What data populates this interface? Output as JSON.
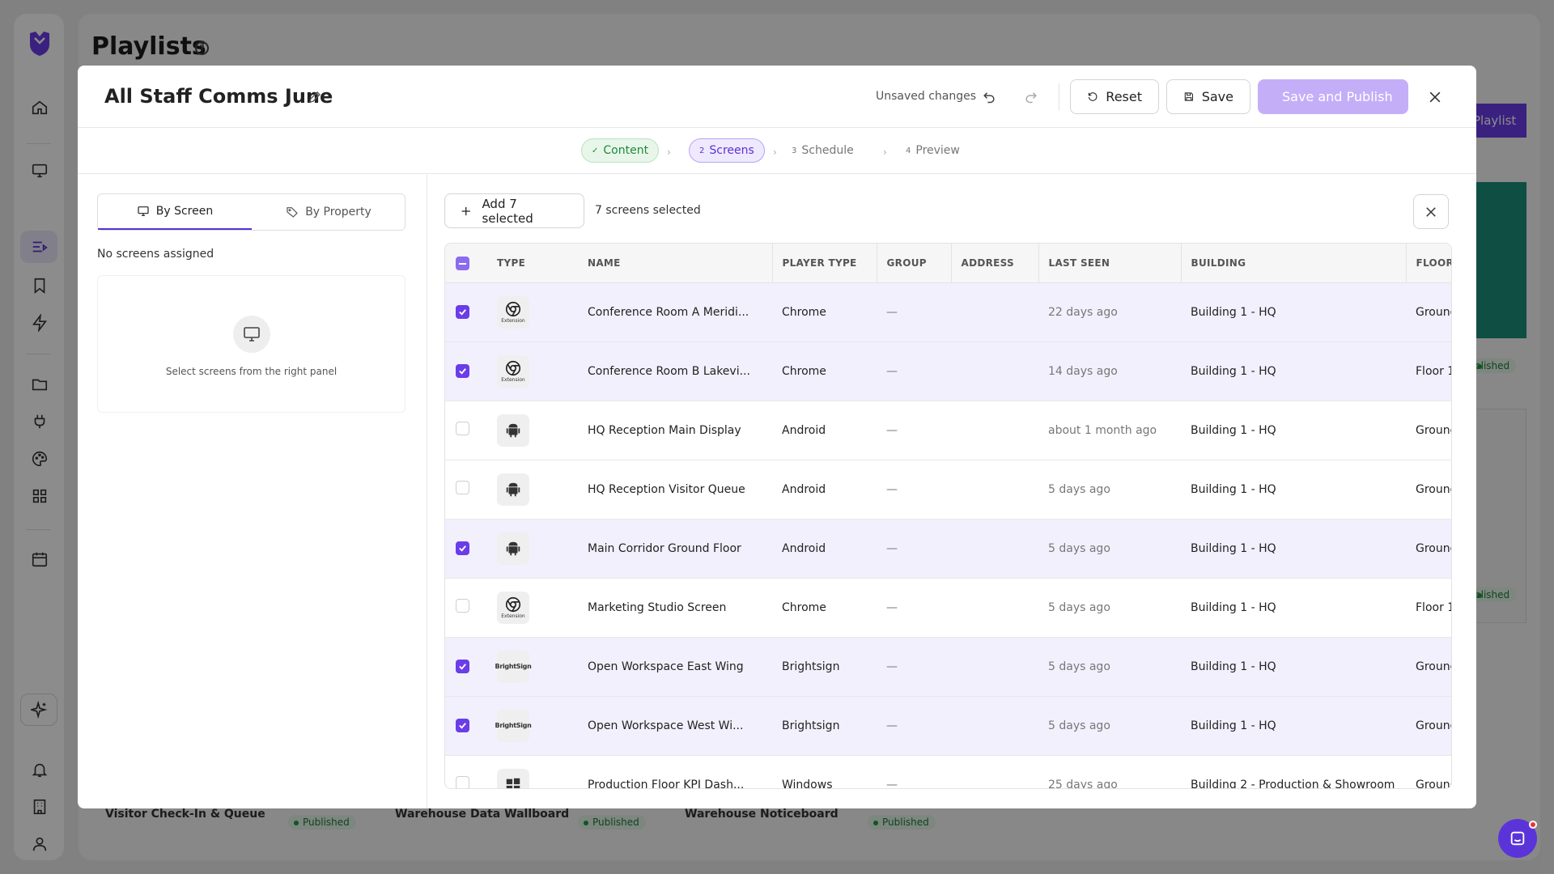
{
  "background": {
    "page_title": "Playlists",
    "new_button_label": "Playlist",
    "cards": [
      {
        "name": "Visitor Check-In & Queue",
        "status": "Published"
      },
      {
        "name": "Warehouse Data Wallboard",
        "status": "Published"
      },
      {
        "name": "Warehouse Noticeboard",
        "status": "Published"
      }
    ],
    "side_statuses": [
      "blished",
      "blished"
    ],
    "brand_color": "#6a3de8"
  },
  "modal": {
    "title": "All Staff Comms June",
    "unsaved": "Unsaved changes",
    "reset_label": "Reset",
    "save_label": "Save",
    "publish_label": "Save and Publish"
  },
  "steps": [
    {
      "num": "✓",
      "label": "Content",
      "state": "done"
    },
    {
      "num": "2",
      "label": "Screens",
      "state": "active"
    },
    {
      "num": "3",
      "label": "Schedule",
      "state": "pending"
    },
    {
      "num": "4",
      "label": "Preview",
      "state": "pending"
    }
  ],
  "left_panel": {
    "tab_screen": "By Screen",
    "tab_property": "By Property",
    "no_screens": "No screens assigned",
    "empty_hint": "Select screens from the right panel"
  },
  "right_panel": {
    "add_label": "Add 7 selected",
    "selected_count": "7 screens selected",
    "columns": [
      "TYPE",
      "NAME",
      "PLAYER TYPE",
      "GROUP",
      "ADDRESS",
      "LAST SEEN",
      "BUILDING",
      "FLOOR"
    ],
    "rows": [
      {
        "checked": true,
        "type": "chrome",
        "name": "Conference Room A Meridi...",
        "player": "Chrome",
        "group": "—",
        "address": "",
        "last_seen": "22 days ago",
        "building": "Building 1 - HQ",
        "floor": "Ground"
      },
      {
        "checked": true,
        "type": "chrome",
        "name": "Conference Room B Lakevi...",
        "player": "Chrome",
        "group": "—",
        "address": "",
        "last_seen": "14 days ago",
        "building": "Building 1 - HQ",
        "floor": "Floor 1"
      },
      {
        "checked": false,
        "type": "android",
        "name": "HQ Reception Main Display",
        "player": "Android",
        "group": "—",
        "address": "",
        "last_seen": "about 1 month ago",
        "building": "Building 1 - HQ",
        "floor": "Ground"
      },
      {
        "checked": false,
        "type": "android",
        "name": "HQ Reception Visitor Queue",
        "player": "Android",
        "group": "—",
        "address": "",
        "last_seen": "5 days ago",
        "building": "Building 1 - HQ",
        "floor": "Ground"
      },
      {
        "checked": true,
        "type": "android",
        "name": "Main Corridor Ground Floor",
        "player": "Android",
        "group": "—",
        "address": "",
        "last_seen": "5 days ago",
        "building": "Building 1 - HQ",
        "floor": "Ground"
      },
      {
        "checked": false,
        "type": "chrome",
        "name": "Marketing Studio Screen",
        "player": "Chrome",
        "group": "—",
        "address": "",
        "last_seen": "5 days ago",
        "building": "Building 1 - HQ",
        "floor": "Floor 1"
      },
      {
        "checked": true,
        "type": "brightsign",
        "name": "Open Workspace East Wing",
        "player": "Brightsign",
        "group": "—",
        "address": "",
        "last_seen": "5 days ago",
        "building": "Building 1 - HQ",
        "floor": "Ground"
      },
      {
        "checked": true,
        "type": "brightsign",
        "name": "Open Workspace West Wi...",
        "player": "Brightsign",
        "group": "—",
        "address": "",
        "last_seen": "5 days ago",
        "building": "Building 1 - HQ",
        "floor": "Ground"
      },
      {
        "checked": false,
        "type": "windows",
        "name": "Production Floor KPI Dash...",
        "player": "Windows",
        "group": "—",
        "address": "",
        "last_seen": "25 days ago",
        "building": "Building 2 - Production & Showroom",
        "floor": "Ground"
      }
    ],
    "type_labels": {
      "extension": "Extension",
      "brightsign": "BrightSign"
    }
  }
}
